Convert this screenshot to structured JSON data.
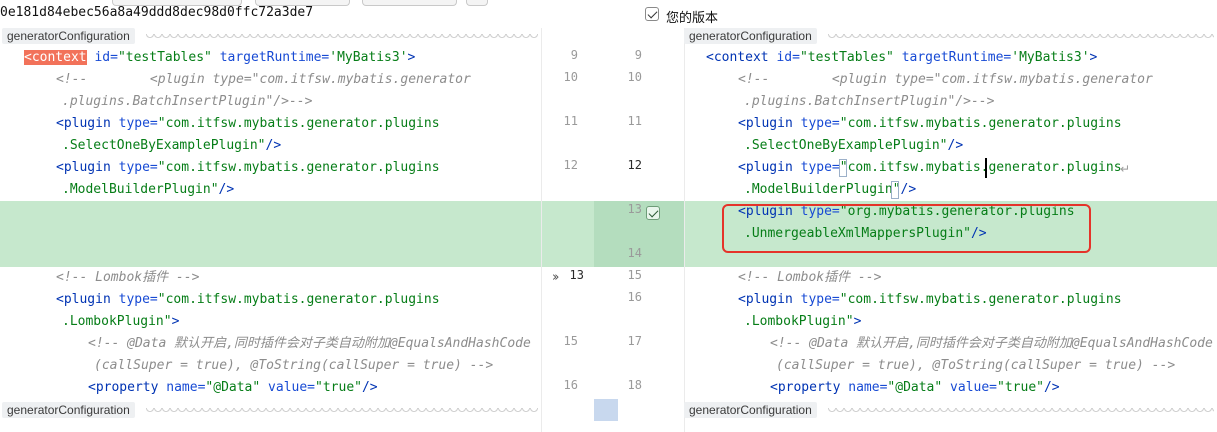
{
  "header": {
    "commit_hash": "0e181d84ebec56a8a49ddd8dec98d0ffc72a3de7",
    "your_version_label": "您的版本"
  },
  "breadcrumbs": {
    "top_left": "generatorConfiguration",
    "top_right": "generatorConfiguration",
    "bottom_left": "generatorConfiguration",
    "bottom_right": "generatorConfiguration"
  },
  "line_numbers": {
    "left": [
      "9",
      "10",
      "11",
      "12",
      "13",
      "15",
      "16"
    ],
    "right": [
      "9",
      "10",
      "11",
      "12",
      "13",
      "14",
      "15",
      "16",
      "17",
      "18"
    ]
  },
  "left_code": {
    "l1_tag": "<context",
    "l1_rest_attr1": "id=",
    "l1_rest_str1": "\"testTables\"",
    "l1_rest_attr2": "targetRuntime=",
    "l1_rest_str2": "'MyBatis3'",
    "l1_end": ">",
    "l2": "<!--        <plugin type=\"com.itfsw.mybatis.generator",
    "l3": ".plugins.BatchInsertPlugin\"/>-->",
    "l4_tag": "<plugin",
    "l4_attr": "type=",
    "l4_str": "\"com.itfsw.mybatis.generator.plugins",
    "l5_str": ".SelectOneByExamplePlugin\"",
    "l5_end": "/>",
    "l6_tag": "<plugin",
    "l6_attr": "type=",
    "l6_str": "\"com.itfsw.mybatis.generator.plugins",
    "l7_str": ".ModelBuilderPlugin\"",
    "l7_end": "/>",
    "l8": "<!-- Lombok插件 -->",
    "l9_tag": "<plugin",
    "l9_attr": "type=",
    "l9_str": "\"com.itfsw.mybatis.generator.plugins",
    "l10_str": ".LombokPlugin\"",
    "l10_end": ">",
    "l11": "<!-- @Data 默认开启,同时插件会对子类自动附加@EqualsAndHashCode",
    "l12": "(callSuper = true), @ToString(callSuper = true) -->",
    "l13_tag": "<property",
    "l13_attr1": "name=",
    "l13_str1": "\"@Data\"",
    "l13_attr2": "value=",
    "l13_str2": "\"true\"",
    "l13_end": "/>"
  },
  "right_code": {
    "r1_tag": "<context",
    "r1_attr1": "id=",
    "r1_str1": "\"testTables\"",
    "r1_attr2": "targetRuntime=",
    "r1_str2": "'MyBatis3'",
    "r1_end": ">",
    "r2": "<!--        <plugin type=\"com.itfsw.mybatis.generator",
    "r3": ".plugins.BatchInsertPlugin\"/>-->",
    "r4_tag": "<plugin",
    "r4_attr": "type=",
    "r4_str": "\"com.itfsw.mybatis.generator.plugins",
    "r5_str": ".SelectOneByExamplePlugin\"",
    "r5_end": "/>",
    "r6_tag": "<plugin",
    "r6_attr": "type=",
    "r6_str": "\"com.itfsw.mybatis.generator.plugins",
    "r7_str": ".ModelBuilderPlugin\"",
    "r7_end": "/>",
    "r8_tag": "<plugin",
    "r8_attr": "type=",
    "r8_str": "\"org.mybatis.generator.plugins",
    "r9_str": ".UnmergeableXmlMappersPlugin\"",
    "r9_end": "/>",
    "r10": "<!-- Lombok插件 -->",
    "r11_tag": "<plugin",
    "r11_attr": "type=",
    "r11_str": "\"com.itfsw.mybatis.generator.plugins",
    "r12_str": ".LombokPlugin\"",
    "r12_end": ">",
    "r13": "<!-- @Data 默认开启,同时插件会对子类自动附加@EqualsAndHashCode",
    "r14": "(callSuper = true), @ToString(callSuper = true) -->",
    "r15_tag": "<property",
    "r15_attr1": "name=",
    "r15_str1": "\"@Data\"",
    "r15_attr2": "value=",
    "r15_str2": "\"true\"",
    "r15_end": "/>"
  },
  "icons": {
    "accept_change": "checkbox-icon",
    "apply_left": "double-chevron-right-icon",
    "wrap": "soft-wrap-icon"
  },
  "colors": {
    "insert_bg": "#c6e8cd",
    "highlight_border": "#e5332a",
    "context_tag_bg": "#f2725a"
  }
}
